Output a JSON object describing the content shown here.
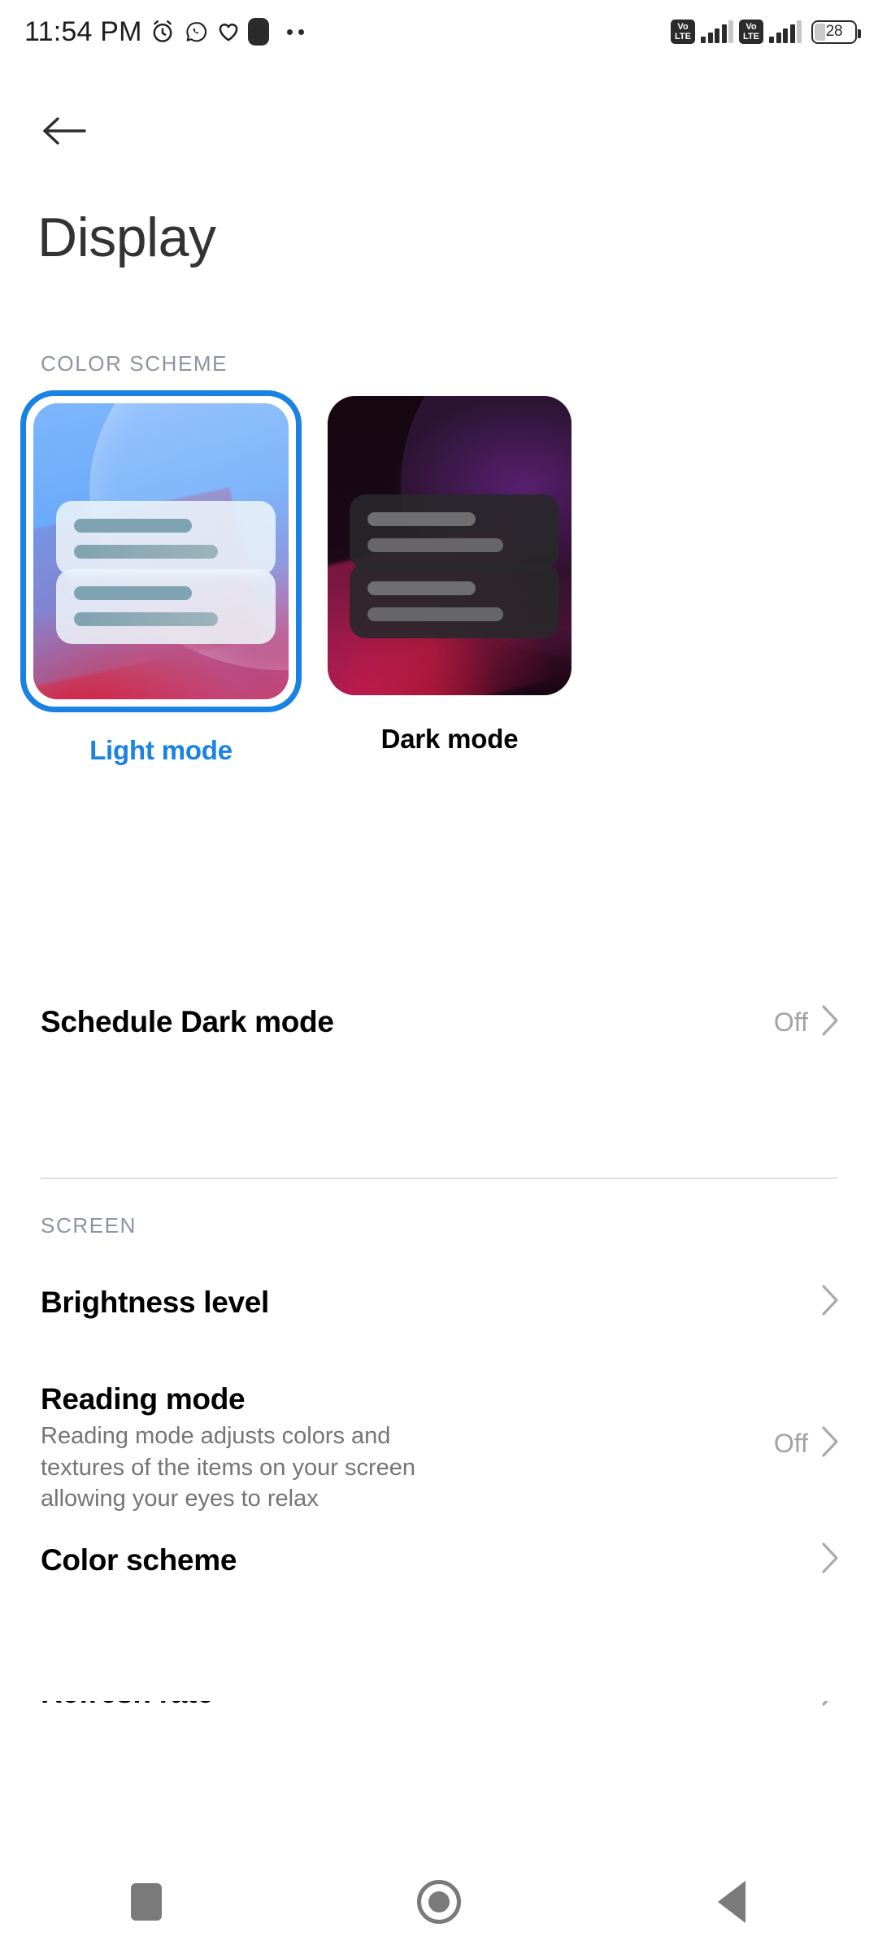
{
  "status_bar": {
    "time": "11:54 PM",
    "left_icons": [
      "alarm-icon",
      "whatsapp-icon",
      "heart-icon",
      "app-icon",
      "more-dots-icon"
    ],
    "sim1_network": "VoLTE",
    "sim2_network": "VoLTE",
    "volte_line1": "Vo",
    "volte_line2": "LTE",
    "battery_percent": "28"
  },
  "header": {
    "back_label": "Back",
    "title": "Display"
  },
  "color_scheme_section": {
    "label": "COLOR SCHEME",
    "options": [
      {
        "id": "light",
        "caption": "Light mode",
        "selected": true
      },
      {
        "id": "dark",
        "caption": "Dark mode",
        "selected": false
      }
    ],
    "schedule_row": {
      "title": "Schedule Dark mode",
      "value": "Off",
      "chevron": "chevron-right-icon"
    }
  },
  "screen_section": {
    "label": "SCREEN",
    "rows": [
      {
        "title": "Brightness level",
        "description": "",
        "value": "",
        "chevron": "chevron-right-icon"
      },
      {
        "title": "Reading mode",
        "description": "Reading mode adjusts colors and textures of the items on your screen allowing your eyes to relax",
        "value": "Off",
        "chevron": "chevron-right-icon"
      },
      {
        "title": "Color scheme",
        "description": "",
        "value": "",
        "chevron": "chevron-right-icon"
      },
      {
        "title": "Refresh rate",
        "description": "",
        "value": "",
        "chevron": "chevron-right-icon"
      }
    ]
  },
  "nav_bar": {
    "recents_label": "Recents",
    "home_label": "Home",
    "back_label": "Back"
  },
  "colors": {
    "accent_blue": "#1a82e2",
    "text_primary": "#000000",
    "text_secondary": "#757575",
    "text_muted": "#a3a3a3",
    "section_label": "#8f92a6",
    "divider": "#e3e3e3",
    "nav_icon": "#7a7a7a",
    "background": "#ffffff"
  }
}
